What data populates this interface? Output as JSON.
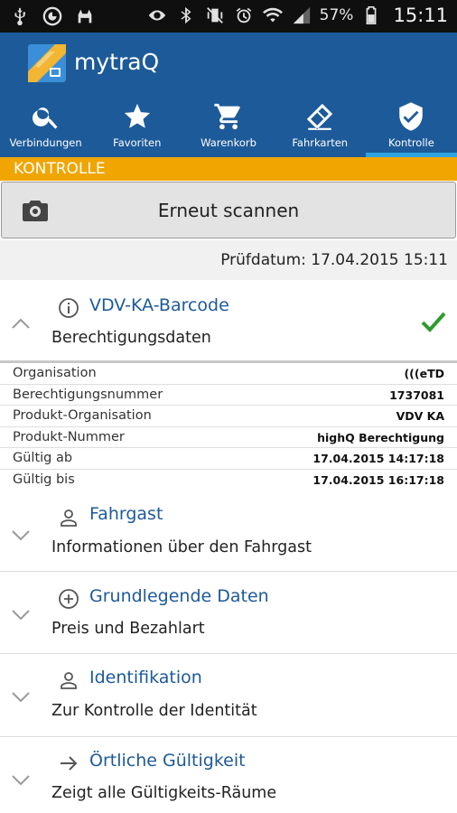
{
  "status_bar": {
    "battery": "57%",
    "time": "15:11"
  },
  "app": {
    "title": "mytraQ"
  },
  "tabs": [
    {
      "label": "Verbindungen",
      "icon": "search-icon"
    },
    {
      "label": "Favoriten",
      "icon": "star-icon"
    },
    {
      "label": "Warenkorb",
      "icon": "cart-icon"
    },
    {
      "label": "Fahrkarten",
      "icon": "ticket-icon"
    },
    {
      "label": "Kontrolle",
      "icon": "shield-check-icon",
      "active": true
    }
  ],
  "section_header": "KONTROLLE",
  "scan_button": {
    "label": "Erneut scannen",
    "icon": "camera-icon"
  },
  "check_date": "Prüfdatum: 17.04.2015 15:11",
  "barcode_section": {
    "title": "VDV-KA-Barcode",
    "subtitle": "Berechtigungsdaten",
    "icon": "info-icon",
    "status_icon": "checkmark-icon",
    "status_color": "#2e9a2e"
  },
  "details": [
    {
      "key": "Organisation",
      "value": "(((eTD"
    },
    {
      "key": "Berechtigungsnummer",
      "value": "1737081"
    },
    {
      "key": "Produkt-Organisation",
      "value": "VDV KA"
    },
    {
      "key": "Produkt-Nummer",
      "value": "highQ Berechtigung"
    },
    {
      "key": "Gültig ab",
      "value": "17.04.2015 14:17:18"
    },
    {
      "key": "Gültig bis",
      "value": "17.04.2015 16:17:18"
    }
  ],
  "sections": [
    {
      "title": "Fahrgast",
      "subtitle": "Informationen über den Fahrgast",
      "icon": "person-icon"
    },
    {
      "title": "Grundlegende Daten",
      "subtitle": "Preis und Bezahlart",
      "icon": "plus-circle-icon"
    },
    {
      "title": "Identifikation",
      "subtitle": "Zur Kontrolle der Identität",
      "icon": "person-icon"
    },
    {
      "title": "Örtliche Gültigkeit",
      "subtitle": "Zeigt alle Gültigkeits-Räume",
      "icon": "arrow-right-icon"
    }
  ],
  "colors": {
    "primary": "#1d5a99",
    "accent": "#f0a500",
    "tab_indicator": "#2ea3e0"
  }
}
